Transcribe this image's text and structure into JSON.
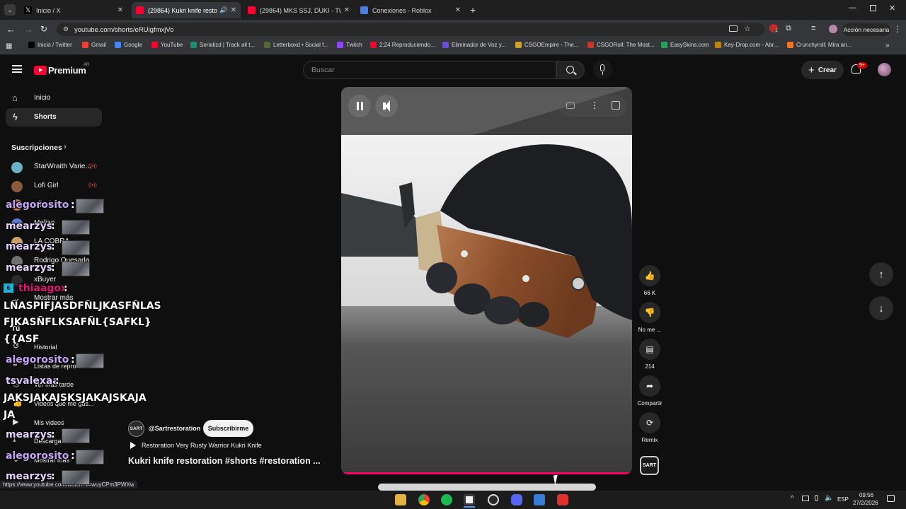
{
  "browser": {
    "tabs": [
      {
        "title": "Inicio / X",
        "icon": "x-logo-icon",
        "active": false
      },
      {
        "title": "(29864) Kukri knife restorati",
        "icon": "youtube-icon",
        "active": true
      },
      {
        "title": "(29864) MKS SSJ, DUKI - TU SI...",
        "icon": "youtube-icon",
        "active": false
      },
      {
        "title": "Conexiones - Roblox",
        "icon": "roblox-icon",
        "active": false
      }
    ],
    "url": "youtube.com/shorts/eRUlgfmxjVo",
    "action_button": "Acción necesaria",
    "profile_badge": "1",
    "bookmarks": [
      "Inicio / Twitter",
      "Gmail",
      "Google",
      "YouTube",
      "Serializd | Track all t...",
      "Letterboxd • Social f...",
      "Twitch",
      "2:24 Reproduciendo...",
      "Eliminador de Voz y...",
      "CSGOEmpire - The...",
      "CSGORoll: The Most...",
      "EasySkins.com",
      "Key-Drop.com - Abr...",
      "Crunchyroll: Mira an..."
    ]
  },
  "youtube": {
    "logo": "Premium",
    "logo_region": "AR",
    "search_placeholder": "Buscar",
    "create_label": "Crear",
    "notif_count": "9+",
    "sidebar": {
      "nav": [
        "Inicio",
        "Shorts"
      ],
      "subs_title": "Suscripciones",
      "subs_items": [
        "StarWraith Varie...",
        "Lofi Girl",
        "rdjavi",
        "Melian",
        "LA COBRA",
        "Rodrigo Quesada",
        "xBuyer"
      ],
      "more_label": "Mostrar más",
      "you_title": "Tú",
      "you_items": [
        "Historial",
        "Listas de reproducción",
        "Ver más tarde",
        "Videos que me gus...",
        "Mis videos",
        "Descargas",
        "Mostrar más"
      ]
    },
    "short": {
      "channel": "@Sartrestoration",
      "channel_avatar_text": "SART",
      "subscribe": "Subscribirme",
      "playlist": "Restoration Very Rusty Warrior Kukri Knife",
      "title": "Kukri knife restoration #shorts #restoration ...",
      "progress": 0.99
    },
    "actions": [
      {
        "icon": "like-icon",
        "label": "66 K"
      },
      {
        "icon": "dislike-icon",
        "label": "No me ..."
      },
      {
        "icon": "comment-icon",
        "label": "214"
      },
      {
        "icon": "share-icon",
        "label": "Compartir"
      },
      {
        "icon": "remix-icon",
        "label": "Remix"
      }
    ],
    "status_url": "https://www.youtube.com/watch?v=wuyCPm3PWXw"
  },
  "chat": [
    {
      "user": "alegorosito",
      "color": "#c7a3f5",
      "kind": "emote"
    },
    {
      "user": "mearzys",
      "color": "#e7d3ff",
      "kind": "emote"
    },
    {
      "user": "mearzys",
      "color": "#e7d3ff",
      "kind": "emote"
    },
    {
      "user": "mearzys",
      "color": "#e7d3ff",
      "kind": "emote"
    },
    {
      "user": "thiaagox",
      "color": "#e3157a",
      "kind": "text",
      "message": "LÑASPIFJASDFÑLJKASFÑLAS FJKASÑFLKSAFÑL{SAFKL}{{ASF"
    },
    {
      "user": "alegorosito",
      "color": "#c7a3f5",
      "kind": "emote"
    },
    {
      "user": "tsvalexaa",
      "color": "#d9c6ff",
      "kind": "text",
      "message": "JAKSJAKAJSKSJAKAJSKAJAJA"
    },
    {
      "user": "mearzys",
      "color": "#e7d3ff",
      "kind": "emote"
    },
    {
      "user": "alegorosito",
      "color": "#c7a3f5",
      "kind": "emote"
    },
    {
      "user": "mearzys",
      "color": "#e7d3ff",
      "kind": "emote"
    },
    {
      "user": "mearzys",
      "color": "#e7d3ff",
      "kind": "emote"
    }
  ],
  "chat_msg_lines": [
    "LÑASPIFJASDFÑLJKASFÑLAS",
    "FJKASÑFLKSAFÑL{SAFKL}",
    "{{ASF",
    "JAKSJAKAJSKSJAKAJSKAJA",
    "JA"
  ],
  "taskbar": {
    "lang": "ESP",
    "time": "09:56",
    "date": "27/2/2026"
  },
  "colors": {
    "yt_red": "#ff0033",
    "accent_pink": "#ff0066"
  }
}
